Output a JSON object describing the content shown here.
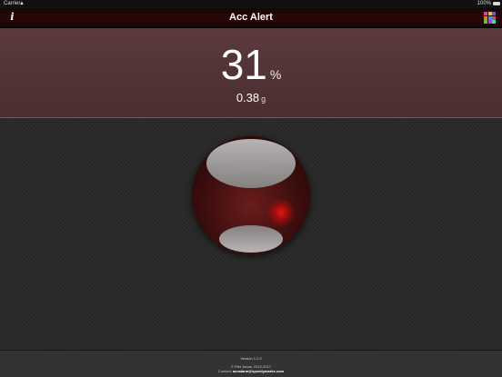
{
  "status_bar": {
    "carrier": "Carrier",
    "time": "",
    "battery_percent": "100%"
  },
  "nav_bar": {
    "title": "Acc Alert",
    "info_label": "i",
    "grid_colors": [
      "#e04a7a",
      "#d9c23a",
      "#6a5acd",
      "#e07a2a",
      "#3a9ad9",
      "#d94a4a",
      "#5ac24a",
      "#9a4ad9",
      "#3ad9c2"
    ]
  },
  "readout": {
    "percent_value": "31",
    "percent_unit": "%",
    "g_value": "0.38",
    "g_unit": "g"
  },
  "footer": {
    "version": "Version 1.2.0",
    "copyright": "© Piet Jonas, 2012-2017",
    "contact_label": "Contact:",
    "contact_email": "accalarm@speedymarks.com"
  },
  "colors": {
    "nav_background": "#2a0708",
    "readout_background": "#5b3a3c",
    "ball_base": "#3e0e0e",
    "ball_dot": "#e01414",
    "page_background": "#2a2a2a"
  },
  "icons": {
    "info": "info-icon",
    "apps": "app-grid-icon",
    "wifi": "wifi-icon",
    "battery": "battery-icon"
  }
}
